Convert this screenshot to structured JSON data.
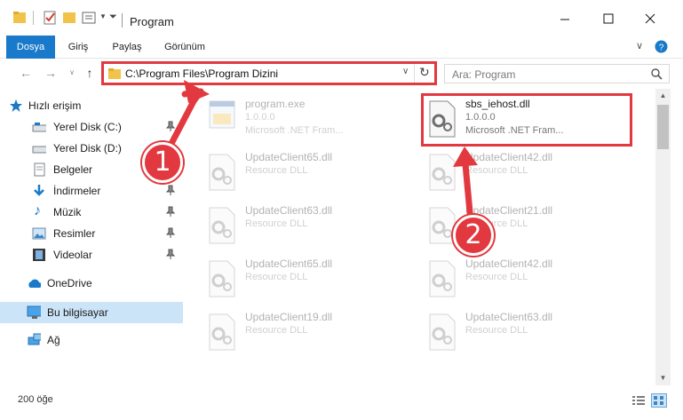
{
  "window": {
    "title": "Program",
    "minimize_icon": "minimize-icon",
    "maximize_icon": "maximize-icon",
    "close_icon": "close-icon"
  },
  "ribbon": {
    "tabs": [
      {
        "label": "Dosya",
        "active": true
      },
      {
        "label": "Giriş",
        "active": false
      },
      {
        "label": "Paylaş",
        "active": false
      },
      {
        "label": "Görünüm",
        "active": false
      }
    ],
    "accent_color": "#1979ca"
  },
  "address": {
    "path": "C:\\Program Files\\Program Dizini",
    "search_placeholder": "Ara: Program"
  },
  "nav": {
    "quick_access": "Hızlı erişim",
    "items": [
      {
        "label": "Yerel Disk (C:)"
      },
      {
        "label": "Yerel Disk (D:)"
      },
      {
        "label": "Belgeler"
      },
      {
        "label": "İndirmeler"
      },
      {
        "label": "Müzik"
      },
      {
        "label": "Resimler"
      },
      {
        "label": "Videolar"
      }
    ],
    "onedrive": "OneDrive",
    "this_pc": "Bu bilgisayar",
    "network": "Ağ"
  },
  "files": {
    "left": [
      {
        "name": "program.exe",
        "line1": "1.0.0.0",
        "line2": "Microsoft .NET Fram..."
      },
      {
        "name": "UpdateClient65.dll",
        "line1": "Resource DLL"
      },
      {
        "name": "UpdateClient63.dll",
        "line1": "Resource DLL"
      },
      {
        "name": "UpdateClient65.dll",
        "line1": "Resource DLL"
      },
      {
        "name": "UpdateClient19.dll",
        "line1": "Resource DLL"
      }
    ],
    "right": [
      {
        "name": "sbs_iehost.dll",
        "line1": "1.0.0.0",
        "line2": "Microsoft .NET Fram..."
      },
      {
        "name": "UpdateClient42.dll",
        "line1": "Resource DLL"
      },
      {
        "name": "UpdateClient21.dll",
        "line1": "Resource DLL"
      },
      {
        "name": "UpdateClient42.dll",
        "line1": "Resource DLL"
      },
      {
        "name": "UpdateClient63.dll",
        "line1": "Resource DLL"
      }
    ]
  },
  "status": {
    "item_count": "200 öğe"
  },
  "callouts": {
    "one": "1",
    "two": "2"
  },
  "highlight_color": "#e2383f"
}
